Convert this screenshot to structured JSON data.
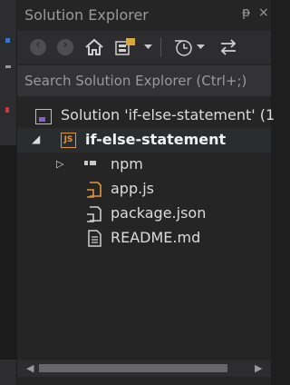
{
  "window": {
    "title": "Solution Explorer",
    "pin_glyph": "ᵽ",
    "close_glyph": "×"
  },
  "toolbar": {
    "icons": [
      "back-icon",
      "forward-icon",
      "home-icon",
      "sync-views-icon",
      "dropdown-icon",
      "pending-changes-icon",
      "dropdown-icon",
      "refresh-icon"
    ]
  },
  "search": {
    "placeholder": "Search Solution Explorer (Ctrl+;)"
  },
  "tree": {
    "solution_label": "Solution 'if-else-statement' (1",
    "project_label": "if-else-statement",
    "project_badge": "JS",
    "items": [
      {
        "label": "npm",
        "icon": "npm-icon",
        "expandable": true
      },
      {
        "label": "app.js",
        "icon": "js-file-icon"
      },
      {
        "label": "package.json",
        "icon": "json-file-icon"
      },
      {
        "label": "README.md",
        "icon": "markdown-file-icon"
      }
    ]
  },
  "colors": {
    "background": "#1e1e1e",
    "panel": "#252526",
    "accent_js": "#e3953b",
    "text": "#dcdcdc"
  }
}
